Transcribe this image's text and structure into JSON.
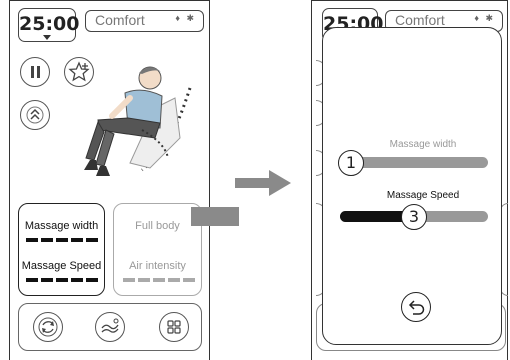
{
  "left_screen": {
    "timer": "25:00",
    "mode_label": "Comfort",
    "mode_icons": "♦ ✱",
    "cards": {
      "left": {
        "massage_width_label": "Massage width",
        "massage_width_level": 5,
        "massage_speed_label": "Massage Speed",
        "massage_speed_level": 5
      },
      "right": {
        "full_body_label": "Full body",
        "air_intensity_label": "Air intensity",
        "air_intensity_level": 5
      }
    }
  },
  "right_screen": {
    "timer": "25:00",
    "mode_label": "Comfort",
    "mode_icons": "♦ ✱",
    "popup": {
      "width_label": "Massage width",
      "width_value": "1",
      "speed_label": "Massage Speed",
      "speed_value": "3"
    }
  },
  "colors": {
    "accent_dark": "#111111",
    "inactive": "#999999",
    "arrow": "#8a8a8a"
  },
  "icons": [
    "pause-icon",
    "star-add-icon",
    "chevron-up-double-icon",
    "refresh-cycle-icon",
    "body-wave-icon",
    "grid-apps-icon",
    "return-icon",
    "bluetooth-icon",
    "arrow-right-icon"
  ]
}
